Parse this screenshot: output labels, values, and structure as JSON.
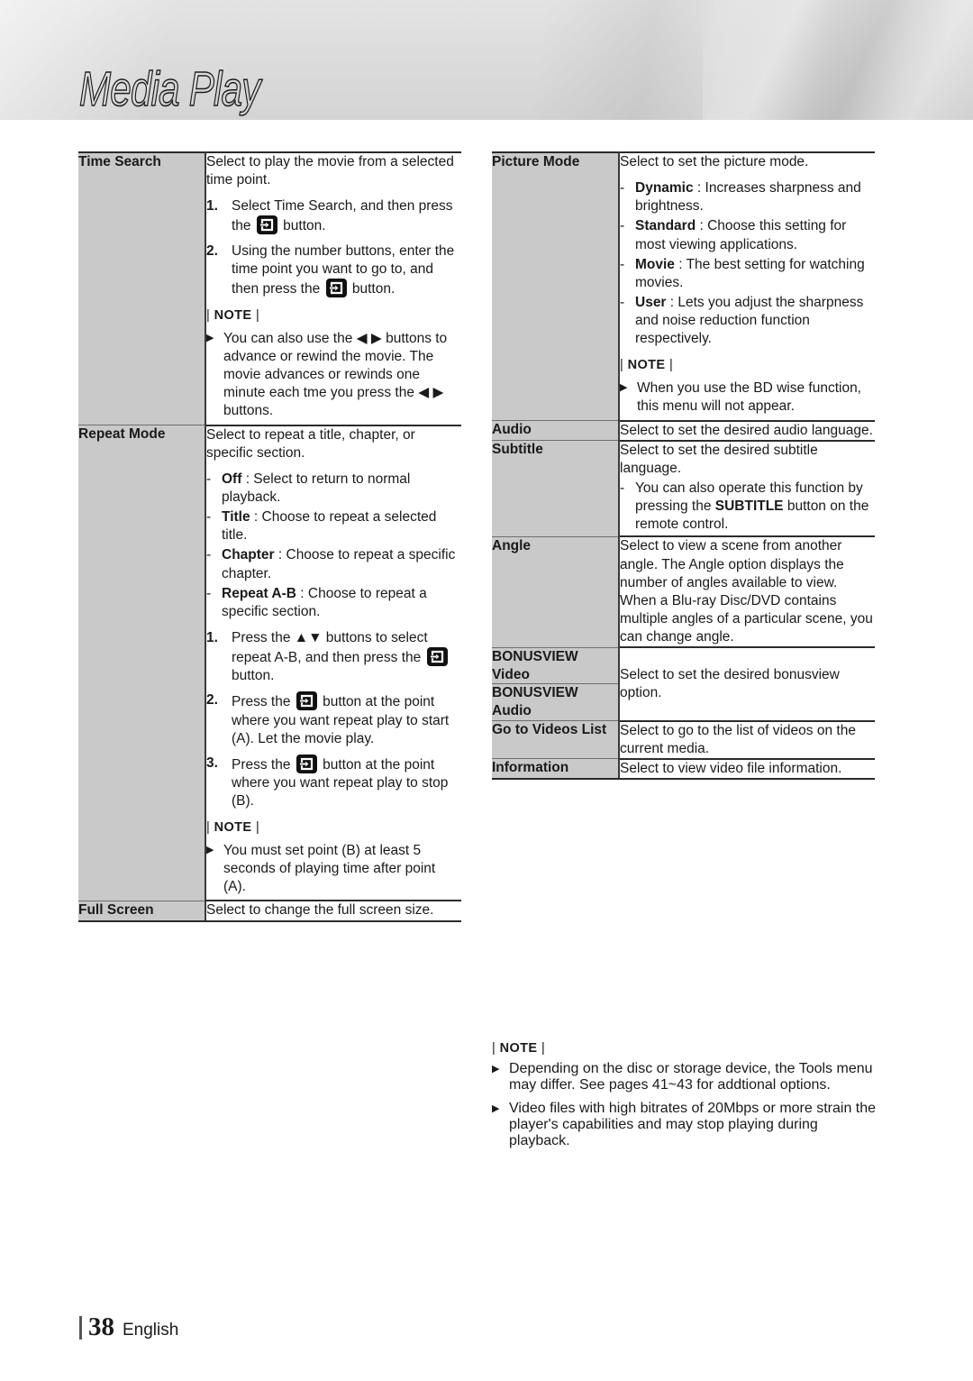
{
  "header": {
    "title": "Media Play"
  },
  "footer": {
    "page_number": "38",
    "language": "English"
  },
  "icons": {
    "enter_button": "enter-key-icon",
    "bullet": "triangle-right-icon"
  },
  "note_label": "NOTE",
  "left_table": {
    "rows": [
      {
        "label": "Time Search",
        "blocks": [
          {
            "kind": "para",
            "text": "Select to play the movie from a selected time point."
          },
          {
            "kind": "num",
            "n": "1.",
            "pre": "Select Time Search, and then press the ",
            "icon": true,
            "post": " button."
          },
          {
            "kind": "num",
            "n": "2.",
            "pre": "Using the number buttons, enter the time point you want to go to, and then press the ",
            "icon": true,
            "post": " button."
          },
          {
            "kind": "note"
          },
          {
            "kind": "bullet",
            "text": "You can also use the ◀ ▶ buttons to advance or rewind the movie. The movie advances or rewinds one minute each tme you press the ◀ ▶ buttons."
          }
        ]
      },
      {
        "label": "Repeat Mode",
        "blocks": [
          {
            "kind": "para",
            "text": "Select to repeat a title, chapter, or specific section."
          },
          {
            "kind": "dash",
            "kw": "Off",
            "text": " : Select to return to normal playback."
          },
          {
            "kind": "dash",
            "kw": "Title",
            "text": " : Choose to repeat a selected title."
          },
          {
            "kind": "dash",
            "kw": "Chapter",
            "text": " : Choose to repeat a specific chapter."
          },
          {
            "kind": "dash",
            "kw": "Repeat A-B",
            "text": " : Choose to repeat a specific section."
          },
          {
            "kind": "num",
            "n": "1.",
            "pre": "Press the ▲▼ buttons to select repeat A-B, and then press the ",
            "icon": true,
            "post": " button."
          },
          {
            "kind": "num",
            "n": "2.",
            "pre": "Press the ",
            "icon": true,
            "post": " button at the point where you want repeat play to start (A). Let the movie play."
          },
          {
            "kind": "num",
            "n": "3.",
            "pre": "Press the ",
            "icon": true,
            "post": " button at the point where you want repeat play to stop (B)."
          },
          {
            "kind": "note"
          },
          {
            "kind": "bullet",
            "text": "You must set point (B) at least 5 seconds of playing time after point (A)."
          }
        ]
      },
      {
        "label": "Full Screen",
        "blocks": [
          {
            "kind": "para",
            "text": "Select to change the full screen size."
          }
        ]
      }
    ]
  },
  "right_table": {
    "rows": [
      {
        "label": "Picture Mode",
        "blocks": [
          {
            "kind": "para",
            "text": "Select to set the picture mode."
          },
          {
            "kind": "dash",
            "kw": "Dynamic",
            "text": " : Increases sharpness and brightness."
          },
          {
            "kind": "dash",
            "kw": "Standard",
            "text": " : Choose this setting for most viewing applications."
          },
          {
            "kind": "dash",
            "kw": "Movie",
            "text": " : The best setting for watching movies."
          },
          {
            "kind": "dash",
            "kw": "User",
            "text": " : Lets you adjust the sharpness and noise reduction function respectively."
          },
          {
            "kind": "note"
          },
          {
            "kind": "bullet",
            "text": "When you use the BD wise function, this menu will not appear."
          }
        ]
      },
      {
        "label": "Audio",
        "blocks": [
          {
            "kind": "para",
            "text": "Select to set the desired audio language."
          }
        ]
      },
      {
        "label": "Subtitle",
        "blocks": [
          {
            "kind": "para",
            "text": "Select to set the desired subtitle language."
          },
          {
            "kind": "dash",
            "kw": "",
            "pre": "You can also operate this function by pressing the ",
            "kw2": "SUBTITLE",
            "post": " button on the remote control."
          }
        ]
      },
      {
        "label": "Angle",
        "blocks": [
          {
            "kind": "para",
            "text": "Select to view a scene from another angle. The Angle option displays the number of angles available to view. When a Blu-ray Disc/DVD contains multiple angles of a particular scene, you can change angle."
          }
        ]
      },
      {
        "label": "BONUSVIEW Video",
        "label_line1": "BONUSVIEW",
        "label_line2": "Video",
        "merged_desc": "Select to set the desired bonusview option."
      },
      {
        "label": "BONUSVIEW Audio",
        "label_line1": "BONUSVIEW",
        "label_line2": "Audio"
      },
      {
        "label": "Go to Videos List",
        "blocks": [
          {
            "kind": "para",
            "text": "Select to go to the list of videos on the current media."
          }
        ]
      },
      {
        "label": "Information",
        "blocks": [
          {
            "kind": "para",
            "text": "Select to view video file information."
          }
        ]
      }
    ]
  },
  "bottom_note": {
    "bullets": [
      "Depending on the disc or storage device, the Tools menu may differ. See pages 41~43 for addtional options.",
      "Video files with high bitrates of 20Mbps or more strain the player's capabilities and may stop playing during playback."
    ]
  }
}
